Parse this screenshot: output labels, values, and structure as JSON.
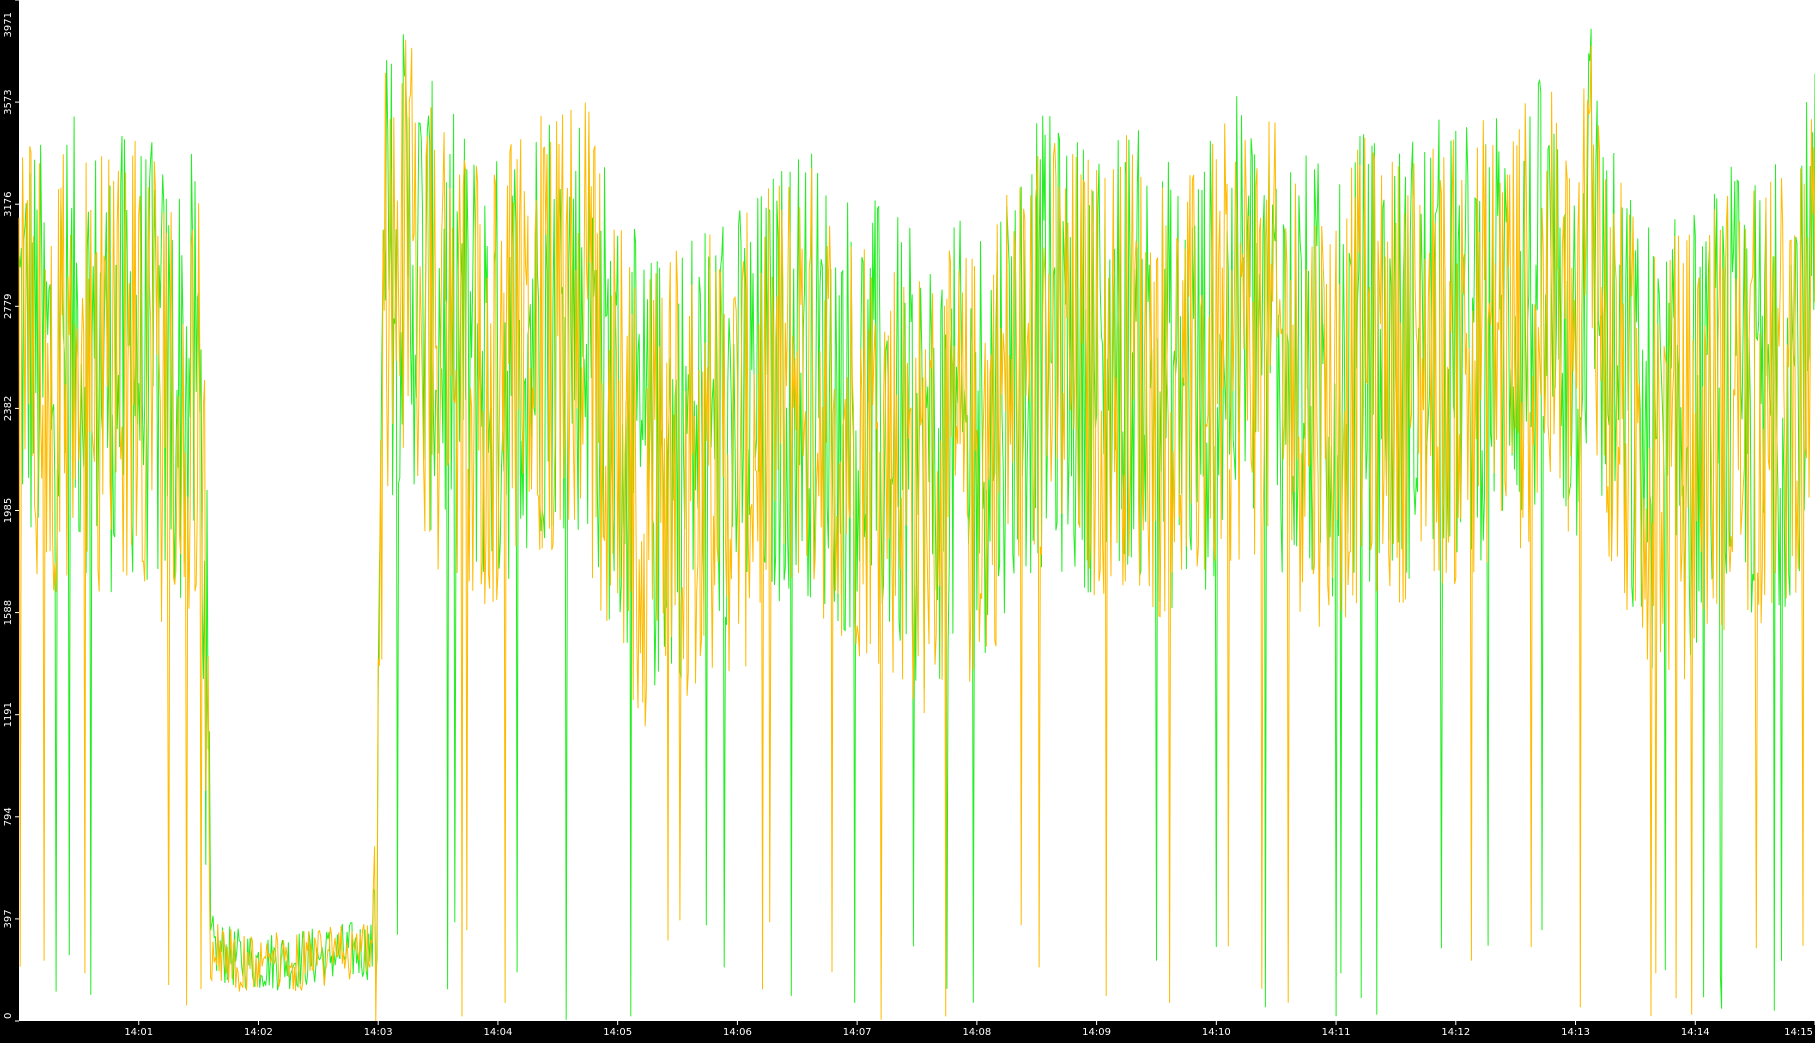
{
  "chart_data": {
    "type": "line",
    "title": "",
    "xlabel": "",
    "ylabel": "",
    "ylim": [
      0,
      3971
    ],
    "y_ticks": [
      "0",
      "397",
      "794",
      "1191",
      "1588",
      "1985",
      "2382",
      "2779",
      "3176",
      "3573",
      "3971"
    ],
    "x_ticks": [
      "14:01",
      "14:02",
      "14:03",
      "14:04",
      "14:05",
      "14:06",
      "14:07",
      "14:08",
      "14:09",
      "14:10",
      "14:11",
      "14:12",
      "14:13",
      "14:14",
      "14:15"
    ],
    "x_range_minutes": [
      0,
      15
    ],
    "grid": false,
    "background": "#ffffff",
    "frame_color": "#000000",
    "series": [
      {
        "color": "#22ee22",
        "points": [
          [
            0.0,
            2700
          ],
          [
            0.25,
            2500
          ],
          [
            0.5,
            2650
          ],
          [
            0.75,
            2550
          ],
          [
            1.0,
            2600
          ],
          [
            1.25,
            2450
          ],
          [
            1.5,
            2500
          ],
          [
            1.55,
            1800
          ],
          [
            1.6,
            300
          ],
          [
            1.75,
            250
          ],
          [
            2.0,
            230
          ],
          [
            2.25,
            240
          ],
          [
            2.5,
            250
          ],
          [
            2.75,
            270
          ],
          [
            2.95,
            280
          ],
          [
            3.0,
            900
          ],
          [
            3.05,
            2900
          ],
          [
            3.25,
            3000
          ],
          [
            3.5,
            2700
          ],
          [
            3.75,
            2600
          ],
          [
            4.0,
            2500
          ],
          [
            4.25,
            2700
          ],
          [
            4.5,
            2800
          ],
          [
            4.75,
            2750
          ],
          [
            5.0,
            2300
          ],
          [
            5.25,
            2100
          ],
          [
            5.5,
            2200
          ],
          [
            5.75,
            2350
          ],
          [
            6.0,
            2300
          ],
          [
            6.25,
            2400
          ],
          [
            6.5,
            2600
          ],
          [
            6.75,
            2450
          ],
          [
            7.0,
            2350
          ],
          [
            7.25,
            2300
          ],
          [
            7.5,
            2150
          ],
          [
            7.75,
            2200
          ],
          [
            8.0,
            2250
          ],
          [
            8.25,
            2500
          ],
          [
            8.5,
            2650
          ],
          [
            8.75,
            2600
          ],
          [
            9.0,
            2550
          ],
          [
            9.25,
            2650
          ],
          [
            9.5,
            2500
          ],
          [
            9.75,
            2450
          ],
          [
            10.0,
            2600
          ],
          [
            10.25,
            2750
          ],
          [
            10.5,
            2650
          ],
          [
            10.75,
            2500
          ],
          [
            11.0,
            2450
          ],
          [
            11.25,
            2600
          ],
          [
            11.5,
            2550
          ],
          [
            11.75,
            2650
          ],
          [
            12.0,
            2600
          ],
          [
            12.25,
            2700
          ],
          [
            12.5,
            2750
          ],
          [
            12.75,
            2800
          ],
          [
            13.0,
            2650
          ],
          [
            13.15,
            3200
          ],
          [
            13.25,
            2600
          ],
          [
            13.5,
            2300
          ],
          [
            13.75,
            2200
          ],
          [
            14.0,
            2300
          ],
          [
            14.25,
            2450
          ],
          [
            14.5,
            2400
          ],
          [
            14.75,
            2500
          ],
          [
            15.0,
            2800
          ]
        ]
      },
      {
        "color": "#ffbb00",
        "points": [
          [
            0.0,
            2650
          ],
          [
            0.25,
            2450
          ],
          [
            0.5,
            2600
          ],
          [
            0.75,
            2500
          ],
          [
            1.0,
            2550
          ],
          [
            1.25,
            2400
          ],
          [
            1.5,
            2450
          ],
          [
            1.55,
            1700
          ],
          [
            1.6,
            280
          ],
          [
            1.75,
            240
          ],
          [
            2.0,
            220
          ],
          [
            2.25,
            230
          ],
          [
            2.5,
            240
          ],
          [
            2.75,
            260
          ],
          [
            2.95,
            270
          ],
          [
            3.0,
            1000
          ],
          [
            3.05,
            2850
          ],
          [
            3.25,
            2950
          ],
          [
            3.5,
            2650
          ],
          [
            3.75,
            2550
          ],
          [
            4.0,
            2450
          ],
          [
            4.25,
            2650
          ],
          [
            4.5,
            2750
          ],
          [
            4.75,
            2700
          ],
          [
            5.0,
            2200
          ],
          [
            5.25,
            2000
          ],
          [
            5.5,
            2100
          ],
          [
            5.75,
            2250
          ],
          [
            6.0,
            2200
          ],
          [
            6.25,
            2350
          ],
          [
            6.5,
            2550
          ],
          [
            6.75,
            2400
          ],
          [
            7.0,
            2300
          ],
          [
            7.25,
            2250
          ],
          [
            7.5,
            2050
          ],
          [
            7.75,
            2100
          ],
          [
            8.0,
            2150
          ],
          [
            8.25,
            2450
          ],
          [
            8.5,
            2600
          ],
          [
            8.75,
            2550
          ],
          [
            9.0,
            2500
          ],
          [
            9.25,
            2600
          ],
          [
            9.5,
            2450
          ],
          [
            9.75,
            2400
          ],
          [
            10.0,
            2550
          ],
          [
            10.25,
            2700
          ],
          [
            10.5,
            2600
          ],
          [
            10.75,
            2450
          ],
          [
            11.0,
            2400
          ],
          [
            11.25,
            2550
          ],
          [
            11.5,
            2500
          ],
          [
            11.75,
            2600
          ],
          [
            12.0,
            2550
          ],
          [
            12.25,
            2650
          ],
          [
            12.5,
            2700
          ],
          [
            12.75,
            2750
          ],
          [
            13.0,
            2600
          ],
          [
            13.15,
            3300
          ],
          [
            13.25,
            2550
          ],
          [
            13.5,
            2250
          ],
          [
            13.75,
            2150
          ],
          [
            14.0,
            2250
          ],
          [
            14.25,
            2400
          ],
          [
            14.5,
            2350
          ],
          [
            14.75,
            2450
          ],
          [
            15.0,
            2750
          ]
        ]
      }
    ]
  }
}
